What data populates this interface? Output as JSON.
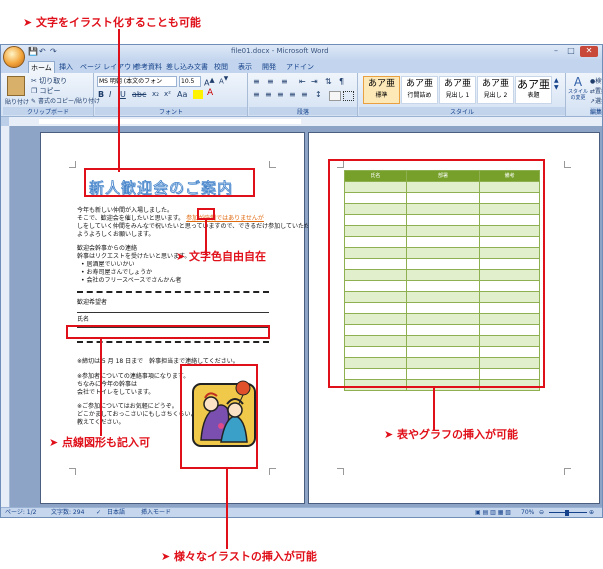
{
  "callouts": {
    "top": "文字をイラスト化することも可能",
    "color": "文字色自由自在",
    "dotted": "点線図形も記入可",
    "table": "表やグラフの挿入が可能",
    "illustration": "様々なイラストの挿入が可能"
  },
  "word": {
    "title": "file01.docx - Microsoft Word",
    "tabs": [
      "ホーム",
      "挿入",
      "ページ レイアウト",
      "参考資料",
      "差し込み文書",
      "校閲",
      "表示",
      "開発",
      "アドイン"
    ],
    "clipboard": {
      "paste": "貼り付け",
      "cut": "切り取り",
      "copy": "コピー",
      "format_painter": "書式のコピー/貼り付け",
      "label": "クリップボード"
    },
    "font": {
      "name": "MS 明朝 (本文のフォン",
      "size": "10.5",
      "label": "フォント",
      "bold": "B",
      "italic": "I",
      "underline": "U"
    },
    "paragraph_label": "段落",
    "styles": [
      {
        "sample": "あア亜",
        "name": "標準"
      },
      {
        "sample": "あア亜",
        "name": "行間詰め"
      },
      {
        "sample": "あア亜",
        "name": "見出し 1"
      },
      {
        "sample": "あア亜",
        "name": "見出し 2"
      },
      {
        "sample": "あア亜",
        "name": "表題"
      }
    ],
    "styles_label": "スタイル",
    "change_styles": "スタイルの変更",
    "editing": {
      "find": "検索",
      "replace": "置換",
      "select": "選択",
      "label": "編集"
    },
    "status": {
      "page": "ページ: 1/2",
      "words": "文字数: 294",
      "language": "日本語",
      "mode": "挿入モード",
      "zoom": "70%"
    }
  },
  "page1": {
    "heading": "新人歓迎会のご案内",
    "highlight": "参加が強制ではありませんが",
    "lines": [
      "今年も新しい仲間が入場しました。",
      "そこで、歓迎会を催したいと思います。",
      "しをしていく仲間をみんなで祝いたいと思っていますので、できるだけ参加していただけ",
      "ようよろしくお願いします。",
      "歓迎会幹事からの連絡",
      "幹事はリクエストを受けたいと思います。",
      "居酒屋でいいかい",
      "お寿司屋さんでしょうか",
      "会社のフリースペースでさんかん者",
      "歓迎希望者",
      "氏名",
      "※締切は 5 月 18 日まで　幹事担当まで連絡してください。",
      "※参加者についての連絡事項になります。",
      "ちなみに今年の幹事は",
      "会社でトイレをしています。",
      "※ご参加についてはお気軽にどうぞ。",
      "どこかましておっこさいにもしさちくらいよろうしさ。",
      "教えてください。"
    ]
  },
  "page2": {
    "table_headers": [
      "氏名",
      "部署",
      "備考"
    ]
  }
}
